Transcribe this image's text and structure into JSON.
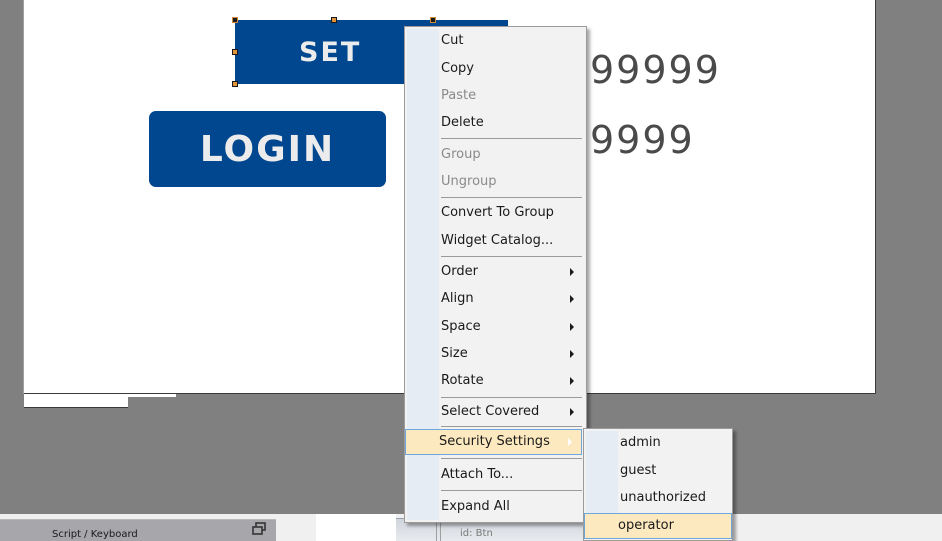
{
  "canvas": {
    "set_button": {
      "label": "SET"
    },
    "login_button": {
      "label": "LOGIN"
    },
    "value_display_1": "99999",
    "value_display_2": "9999",
    "button_color": "#00478f"
  },
  "context_menu": {
    "items": [
      {
        "label": "Cut",
        "enabled": true
      },
      {
        "label": "Copy",
        "enabled": true
      },
      {
        "label": "Paste",
        "enabled": false
      },
      {
        "label": "Delete",
        "enabled": true
      },
      {
        "label": "Group",
        "enabled": false
      },
      {
        "label": "Ungroup",
        "enabled": false
      },
      {
        "label": "Convert To Group",
        "enabled": true
      },
      {
        "label": "Widget Catalog...",
        "enabled": true
      },
      {
        "label": "Order",
        "enabled": true,
        "submenu": true
      },
      {
        "label": "Align",
        "enabled": true,
        "submenu": true
      },
      {
        "label": "Space",
        "enabled": true,
        "submenu": true
      },
      {
        "label": "Size",
        "enabled": true,
        "submenu": true
      },
      {
        "label": "Rotate",
        "enabled": true,
        "submenu": true
      },
      {
        "label": "Select Covered",
        "enabled": true,
        "submenu": true
      },
      {
        "label": "Security Settings",
        "enabled": true,
        "submenu": true,
        "highlighted": true
      },
      {
        "label": "Attach To...",
        "enabled": true
      },
      {
        "label": "Expand All",
        "enabled": true
      }
    ],
    "highlight_color": "#fde9bf"
  },
  "security_submenu": {
    "items": [
      {
        "label": "admin"
      },
      {
        "label": "guest"
      },
      {
        "label": "unauthorized"
      },
      {
        "label": "operator",
        "highlighted": true
      }
    ]
  },
  "bottom_panel": {
    "script_panel_title": "Script / Keyboard",
    "restore_icon": "restore-window-icon",
    "properties_text": "id: Btn"
  }
}
